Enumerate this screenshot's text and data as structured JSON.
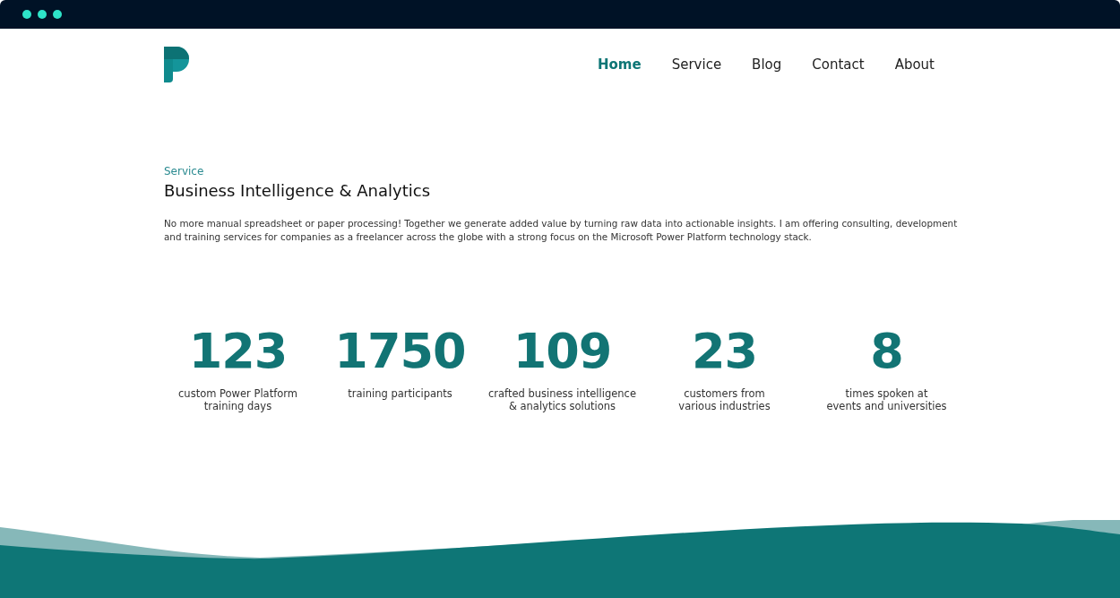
{
  "nav": [
    {
      "label": "Home",
      "selected": true
    },
    {
      "label": "Service",
      "selected": false
    },
    {
      "label": "Blog",
      "selected": false
    },
    {
      "label": "Contact",
      "selected": false
    },
    {
      "label": "About",
      "selected": false
    }
  ],
  "section": {
    "eyebrow": "Service",
    "title": "Business Intelligence & Analytics",
    "body": "No more manual spreadsheet or paper processing! Together we generate added value by turning raw data into actionable insights. I am offering consulting, development and training services for companies as a freelancer across the globe with a strong focus on the Microsoft Power Platform technology stack."
  },
  "stats": [
    {
      "value": "123",
      "lines": [
        "custom Power Platform",
        "training days"
      ]
    },
    {
      "value": "1750",
      "lines": [
        "training participants"
      ]
    },
    {
      "value": "109",
      "lines": [
        "crafted business intelligence",
        "& analytics solutions"
      ]
    },
    {
      "value": "23",
      "lines": [
        "customers from",
        "various industries"
      ]
    },
    {
      "value": "8",
      "lines": [
        "times spoken at",
        "events and universities"
      ]
    }
  ]
}
